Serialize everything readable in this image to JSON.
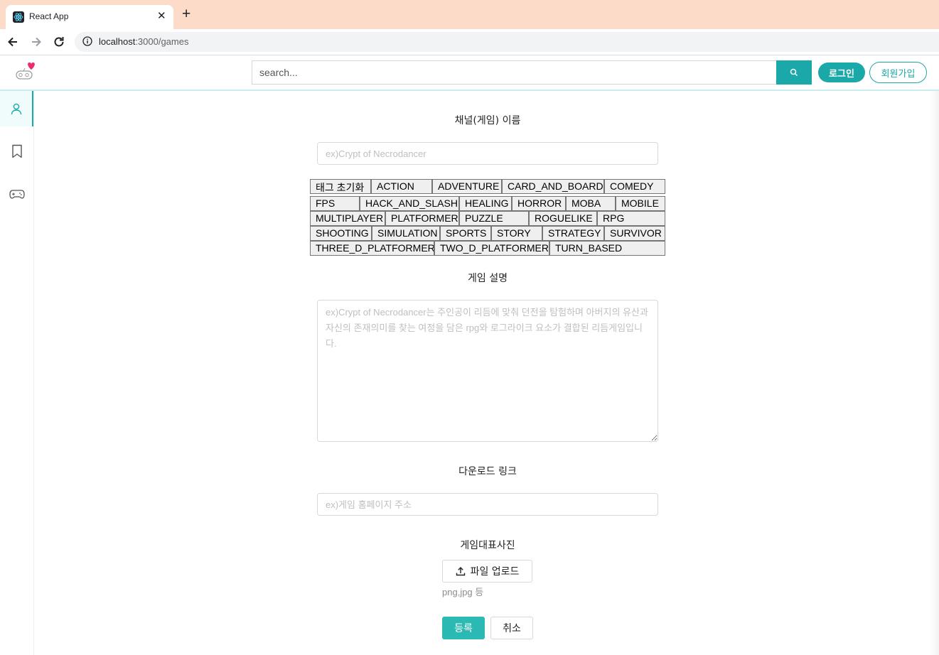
{
  "browser": {
    "tab_title": "React App",
    "url_host": "localhost",
    "url_path": ":3000/games"
  },
  "header": {
    "search_placeholder": "search...",
    "login_label": "로그인",
    "signup_label": "회원가입",
    "accent_color": "#1aa8a8"
  },
  "sidebar": {
    "items": [
      "user-icon",
      "bookmark-icon",
      "gamepad-icon"
    ],
    "active": "user-icon"
  },
  "form": {
    "name_label": "채널(게임) 이름",
    "name_placeholder": "ex)Crypt of Necrodancer",
    "tags": [
      [
        "태그 초기화",
        "ACTION",
        "ADVENTURE",
        "CARD_AND_BOARD",
        "COMEDY"
      ],
      [
        "FPS",
        "HACK_AND_SLASH",
        "HEALING",
        "HORROR",
        "MOBA",
        "MOBILE"
      ],
      [
        "MULTIPLAYER",
        "PLATFORMER",
        "PUZZLE",
        "ROGUELIKE",
        "RPG"
      ],
      [
        "SHOOTING",
        "SIMULATION",
        "SPORTS",
        "STORY",
        "STRATEGY",
        "SURVIVOR"
      ],
      [
        "THREE_D_PLATFORMER",
        "TWO_D_PLATFORMER",
        "TURN_BASED"
      ]
    ],
    "description_label": "게임 설명",
    "description_placeholder": "ex)Crypt of Necrodancer는 주인공이 리듬에 맞춰 던전을 탐험하며 아버지의 유산과 자신의 존재의미를 찾는 여정을 담은 rpg와 로그라이크 요소가 결합된 리듬게임입니다.",
    "download_label": "다운로드 링크",
    "download_placeholder": "ex)게임 홈페이지 주소",
    "image_label": "게임대표사진",
    "upload_label": "파일 업로드",
    "upload_hint": "png,jpg 등",
    "submit_label": "등록",
    "cancel_label": "취소"
  }
}
